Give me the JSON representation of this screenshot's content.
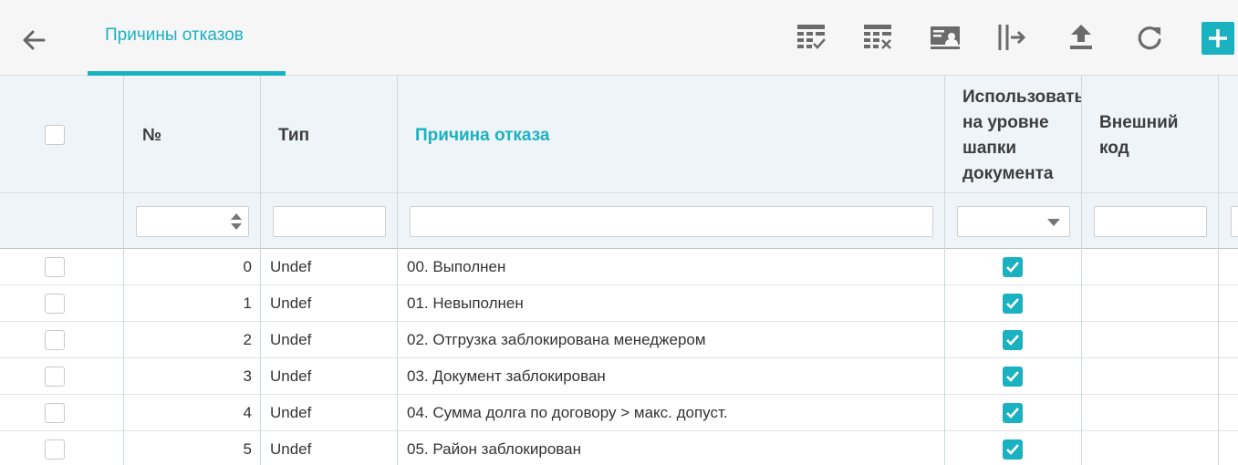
{
  "header": {
    "tab_title": "Причины отказов",
    "accent_color": "#1ab1c1",
    "toolbar": [
      {
        "name": "table-check-icon"
      },
      {
        "name": "table-remove-icon"
      },
      {
        "name": "presentation-user-icon"
      },
      {
        "name": "split-columns-icon"
      },
      {
        "name": "upload-icon"
      },
      {
        "name": "refresh-icon"
      }
    ]
  },
  "table": {
    "columns": {
      "number": "№",
      "type": "Тип",
      "reason": "Причина отказа",
      "header_level_l1": "Использовать",
      "header_level_l2": "на уровне",
      "header_level_l3": "шапки",
      "header_level_l4": "документа",
      "external_l1": "Внешний",
      "external_l2": "код"
    },
    "rows": [
      {
        "number": "0",
        "type": "Undef",
        "reason": "00. Выполнен",
        "header_level": true,
        "external": ""
      },
      {
        "number": "1",
        "type": "Undef",
        "reason": "01. Невыполнен",
        "header_level": true,
        "external": ""
      },
      {
        "number": "2",
        "type": "Undef",
        "reason": "02. Отгрузка заблокирована менеджером",
        "header_level": true,
        "external": ""
      },
      {
        "number": "3",
        "type": "Undef",
        "reason": "03. Документ заблокирован",
        "header_level": true,
        "external": ""
      },
      {
        "number": "4",
        "type": "Undef",
        "reason": "04. Сумма долга по договору > макс. допуст.",
        "header_level": true,
        "external": ""
      },
      {
        "number": "5",
        "type": "Undef",
        "reason": "05. Район заблокирован",
        "header_level": true,
        "external": ""
      }
    ]
  }
}
